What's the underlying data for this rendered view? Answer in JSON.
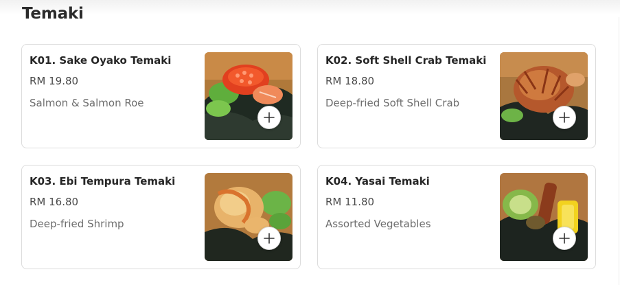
{
  "section": {
    "title": "Temaki"
  },
  "items": [
    {
      "name": "K01. Sake Oyako Temaki",
      "price": "RM 19.80",
      "description": "Salmon & Salmon Roe",
      "image_icon": "salmon-roe-temaki-photo"
    },
    {
      "name": "K02. Soft Shell Crab Temaki",
      "price": "RM 18.80",
      "description": "Deep-fried Soft Shell Crab",
      "image_icon": "soft-shell-crab-temaki-photo"
    },
    {
      "name": "K03. Ebi Tempura Temaki",
      "price": "RM 16.80",
      "description": "Deep-fried Shrimp",
      "image_icon": "ebi-tempura-temaki-photo"
    },
    {
      "name": "K04. Yasai Temaki",
      "price": "RM 11.80",
      "description": "Assorted Vegetables",
      "image_icon": "yasai-temaki-photo"
    }
  ],
  "add_icon": "plus-icon"
}
